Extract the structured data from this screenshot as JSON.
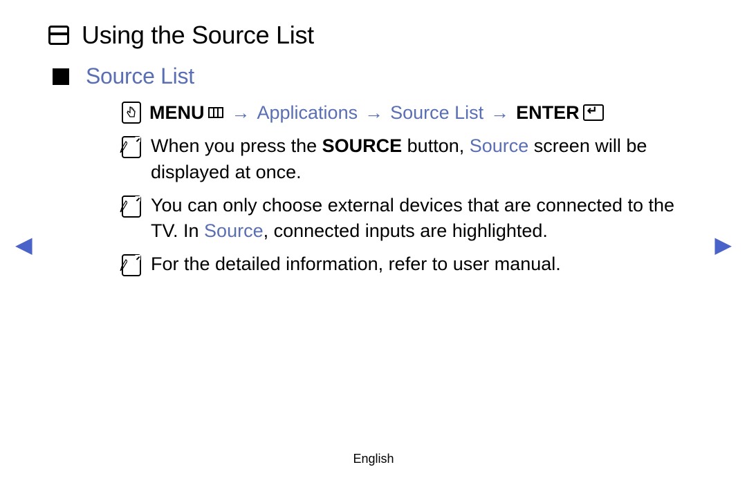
{
  "heading": "Using the Source List",
  "subheading": "Source List",
  "nav_path": {
    "menu_label": "MENU",
    "applications": "Applications",
    "source_list": "Source List",
    "enter_label": "ENTER",
    "arrow": "→"
  },
  "notes": [
    {
      "pre": "When you press the ",
      "bold1": "SOURCE",
      "mid1": " button, ",
      "blue1": "Source",
      "post": " screen will be displayed at once."
    },
    {
      "pre": "You can only choose external devices that are connected to the TV. In ",
      "blue1": "Source",
      "post": ", connected inputs are highlighted."
    },
    {
      "pre": "For the detailed information, refer to user manual."
    }
  ],
  "footer": "English"
}
